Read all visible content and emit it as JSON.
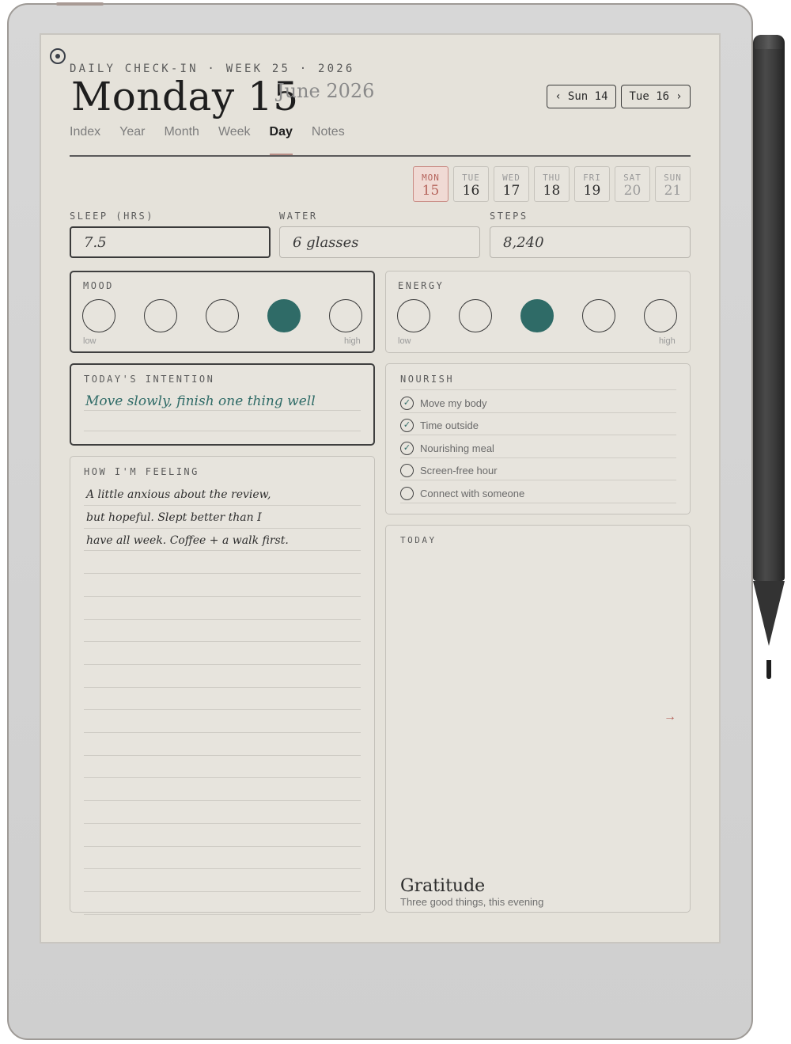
{
  "header": {
    "eyebrow": "DAILY CHECK-IN · WEEK 25 · 2026",
    "day_title": "Monday 15",
    "month_year": "June 2026",
    "prev_label": "Sun 14",
    "next_label": "Tue 16",
    "prev_chevron": "‹",
    "next_chevron": "›"
  },
  "tabs": [
    {
      "label": "Index"
    },
    {
      "label": "Year"
    },
    {
      "label": "Month"
    },
    {
      "label": "Week"
    },
    {
      "label": "Day",
      "active": true
    },
    {
      "label": "Notes"
    }
  ],
  "week_strip": [
    {
      "day": "MON",
      "date": "15",
      "current": true
    },
    {
      "day": "TUE",
      "date": "16"
    },
    {
      "day": "WED",
      "date": "17"
    },
    {
      "day": "THU",
      "date": "18"
    },
    {
      "day": "FRI",
      "date": "19"
    },
    {
      "day": "SAT",
      "date": "20"
    },
    {
      "day": "SUN",
      "date": "21"
    }
  ],
  "metrics": {
    "sleep": {
      "label": "SLEEP (HRS)",
      "value": "7.5"
    },
    "water": {
      "label": "WATER",
      "value": "6 glasses"
    },
    "steps": {
      "label": "STEPS",
      "value": "8,240"
    }
  },
  "mood": {
    "label": "MOOD",
    "low": "low",
    "high": "high",
    "selected": 4,
    "scale": 5
  },
  "energy": {
    "label": "ENERGY",
    "low": "low",
    "high": "high",
    "selected": 3,
    "scale": 5
  },
  "intention": {
    "label": "TODAY'S INTENTION",
    "text": "Move slowly, finish one thing well"
  },
  "nourish": {
    "label": "NOURISH",
    "items": [
      {
        "label": "Move my body",
        "done": true
      },
      {
        "label": "Time outside",
        "done": true
      },
      {
        "label": "Nourishing meal",
        "done": true
      },
      {
        "label": "Screen-free hour",
        "done": false
      },
      {
        "label": "Connect with someone",
        "done": false
      }
    ]
  },
  "feeling": {
    "label": "HOW I'M FEELING",
    "lines": [
      "A little anxious about the review,",
      "but hopeful. Slept better than I",
      "have all week. Coffee + a walk first."
    ]
  },
  "today": {
    "label": "TODAY",
    "arrow": "→",
    "gratitude_title": "Gratitude",
    "gratitude_sub": "Three good things, this evening"
  },
  "colors": {
    "accent_teal": "#2f6b67",
    "accent_rose": "#b5645c",
    "paper": "#e5e2da"
  },
  "icons": {
    "menu": "menu-dot-icon",
    "check": "check-circle-icon",
    "arrow": "arrow-right-icon"
  }
}
